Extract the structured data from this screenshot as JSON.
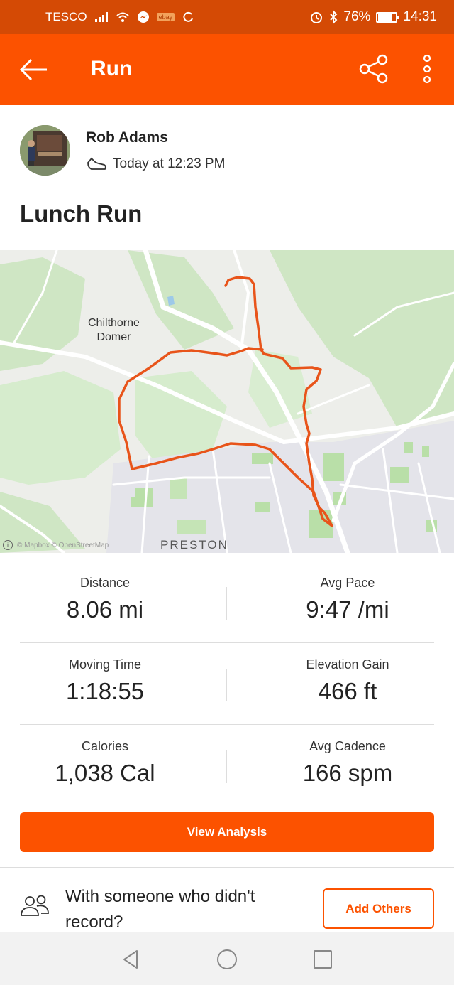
{
  "status_bar": {
    "carrier": "TESCO",
    "battery_percent": "76%",
    "battery_level": 0.76,
    "time": "14:31"
  },
  "app_bar": {
    "title": "Run",
    "icons": [
      "back-arrow-icon",
      "share-icon",
      "more-vertical-icon"
    ]
  },
  "athlete": {
    "name": "Rob Adams",
    "activity_time": "Today at 12:23 PM"
  },
  "activity": {
    "title": "Lunch Run"
  },
  "map": {
    "place_labels": [
      "Chilthorne",
      "Domer",
      "PRESTON"
    ],
    "attribution": "© Mapbox © OpenStreetMap",
    "route_color": "#e8541a"
  },
  "stats": [
    {
      "left": {
        "label": "Distance",
        "value": "8.06 mi"
      },
      "right": {
        "label": "Avg Pace",
        "value": "9:47 /mi"
      }
    },
    {
      "left": {
        "label": "Moving Time",
        "value": "1:18:55"
      },
      "right": {
        "label": "Elevation Gain",
        "value": "466 ft"
      }
    },
    {
      "left": {
        "label": "Calories",
        "value": "1,038 Cal"
      },
      "right": {
        "label": "Avg Cadence",
        "value": "166 spm"
      }
    }
  ],
  "actions": {
    "view_analysis": "View Analysis",
    "with_someone": "With someone who didn't record?",
    "add_others": "Add Others"
  },
  "colors": {
    "brand_orange": "#fc5200",
    "status_bar": "#d44a05"
  }
}
